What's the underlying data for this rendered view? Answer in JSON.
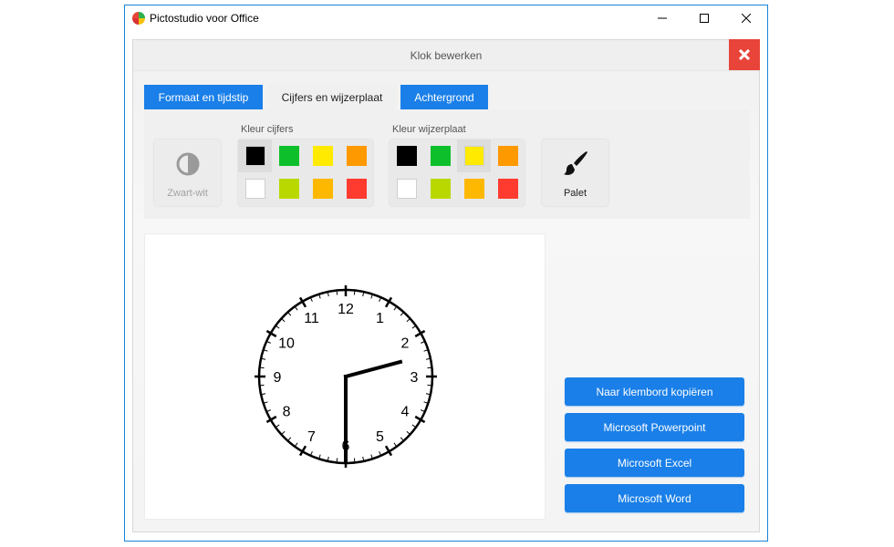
{
  "window": {
    "title": "Pictostudio voor Office",
    "icon": "pictostudio-logo"
  },
  "dialog": {
    "title": "Klok bewerken"
  },
  "tabs": [
    {
      "label": "Formaat en tijdstip"
    },
    {
      "label": "Cijfers en wijzerplaat",
      "active": true
    },
    {
      "label": "Achtergrond"
    }
  ],
  "toolbar": {
    "bw_label": "Zwart-wit",
    "digits_label": "Kleur cijfers",
    "dial_label": "Kleur wijzerplaat",
    "palet_label": "Palet",
    "digit_colors": [
      "#000000",
      "#0dc02b",
      "#ffea00",
      "#ff9900",
      "#ffffff",
      "#b9d800",
      "#ffb800",
      "#ff3b30"
    ],
    "digit_selected": 0,
    "dial_colors": [
      "#000000",
      "#0dc02b",
      "#ffea00",
      "#ff9900",
      "#ffffff",
      "#b9d800",
      "#ffb800",
      "#ff3b30"
    ],
    "dial_selected": 2
  },
  "clock": {
    "numerals": [
      "12",
      "1",
      "2",
      "3",
      "4",
      "5",
      "6",
      "7",
      "8",
      "9",
      "10",
      "11"
    ],
    "time": {
      "hour": 2,
      "minute": 30
    }
  },
  "actions": {
    "clipboard": "Naar klembord kopiëren",
    "powerpoint": "Microsoft Powerpoint",
    "excel": "Microsoft Excel",
    "word": "Microsoft Word"
  },
  "colors": {
    "accent": "#1a7fe8",
    "close": "#e8443a"
  }
}
